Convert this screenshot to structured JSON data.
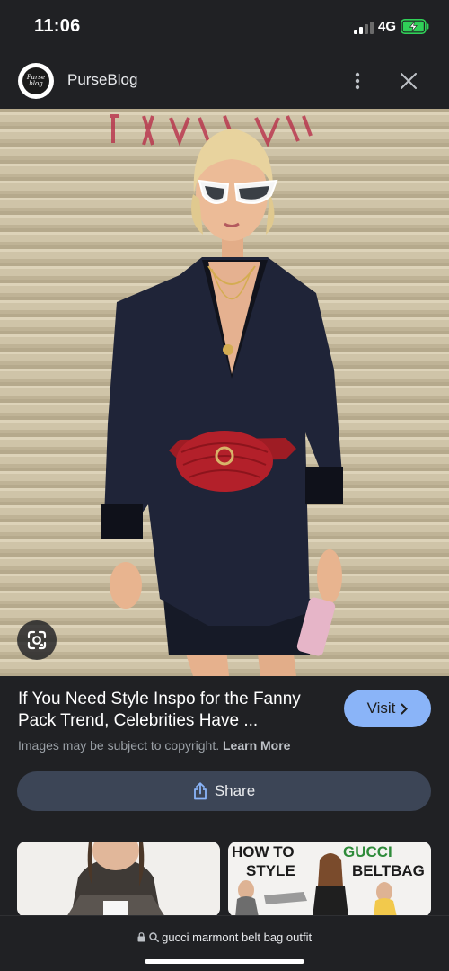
{
  "status_bar": {
    "time": "11:06",
    "network": "4G",
    "signal_bars_active": 2,
    "signal_bars_total": 4,
    "battery_charging": true,
    "battery_color": "#30d158"
  },
  "header": {
    "source_name": "PurseBlog",
    "logo_text": [
      "Purse",
      "blog"
    ],
    "more_icon": "more-vert-icon",
    "close_icon": "close-icon"
  },
  "image": {
    "lens_icon": "google-lens-icon"
  },
  "result": {
    "title": "If You Need Style Inspo for the Fanny Pack Trend, Celebrities Have ...",
    "visit_label": "Visit",
    "copyright_text": "Images may be subject to copyright.",
    "learn_more_label": "Learn More",
    "share_label": "Share"
  },
  "related": {
    "card2_lines": [
      "HOW TO",
      "STYLE",
      "GUCCI",
      "BELTBAG"
    ]
  },
  "bottom_bar": {
    "url": "gucci marmont belt bag outfit"
  },
  "colors": {
    "background": "#202124",
    "accent": "#8ab4f8",
    "share_button": "#3c4556",
    "bag_red": "#b3202a"
  }
}
